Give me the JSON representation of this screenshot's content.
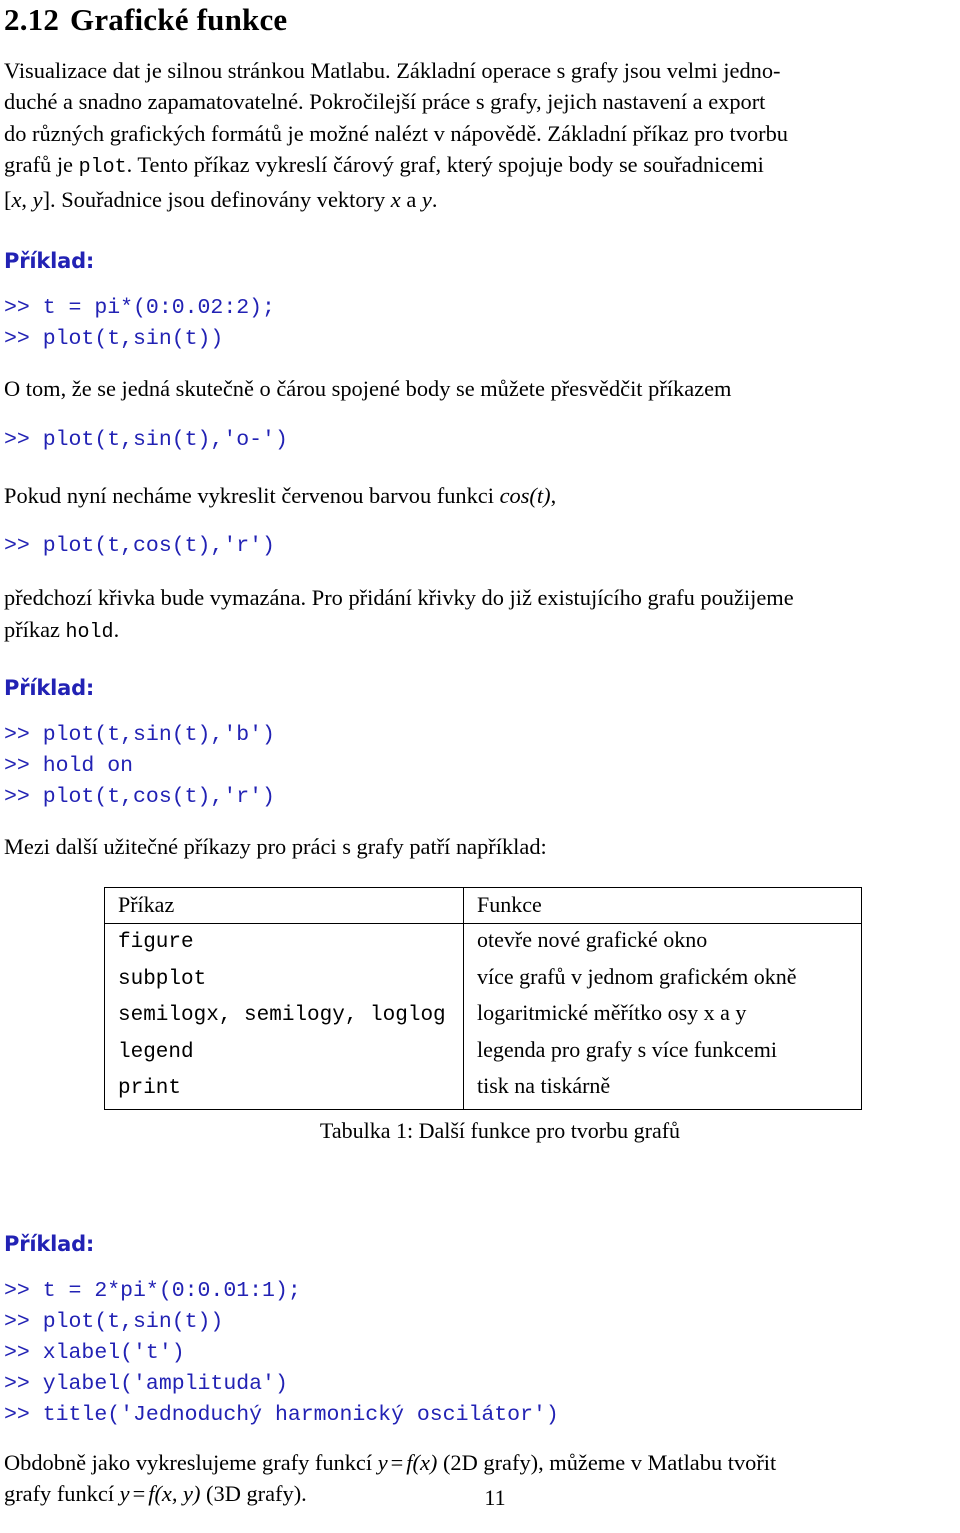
{
  "document": {
    "page_number": "11",
    "code_color": "#2222b4",
    "text_color": "#000000",
    "background_color": "#ffffff"
  },
  "section": {
    "number": "2.12",
    "title": "Grafické funkce"
  },
  "paragraphs": {
    "intro_a": "Visualizace dat je silnou stránkou Matlabu. Základní operace s grafy jsou velmi jedno-",
    "intro_b": "duché a snadno zapamatovatelné. Pokročilejší práce s grafy, jejich nastavení a export",
    "intro_c": "do různých grafických formátů je možné nalézt v nápovědě. Základní příkaz pro tvorbu",
    "intro_d_1": "grafů je ",
    "intro_d_code": "plot",
    "intro_d_2": ". Tento příkaz vykreslí čárový graf, který spojuje body se souřadnicemi",
    "intro_e_1": "[",
    "intro_e_x": "x",
    "intro_e_comma": ", ",
    "intro_e_y": "y",
    "intro_e_2": "]. Souřadnice jsou definovány vektory ",
    "intro_e_x2": "x",
    "intro_e_3": " a ",
    "intro_e_y2": "y",
    "intro_e_4": ".",
    "after_first_code": "O tom, že se jedná skutečně o čárou spojené body se můžete přesvědčit příkazem",
    "before_red_1": "Pokud nyní necháme vykreslit červenou barvou funkci ",
    "before_red_math": "cos(t)",
    "before_red_2": ",",
    "after_red_a": "předchozí křivka bude vymazána. Pro přidání křivky do již existujícího grafu použijeme",
    "after_red_b_1": "příkaz ",
    "after_red_b_code": "hold",
    "after_red_b_2": ".",
    "before_table": "Mezi další užitečné příkazy pro práci s grafy patří například:",
    "closing_a_1": "Obdobně jako vykreslujeme grafy funkcí ",
    "closing_a_y": "y",
    "closing_a_eq": "=",
    "closing_a_f": "f",
    "closing_a_arg": "(x)",
    "closing_a_2": " (2D grafy), můžeme v Matlabu tvořit",
    "closing_b_1": "grafy funkcí ",
    "closing_b_y": "y",
    "closing_b_eq": "=",
    "closing_b_f": "f",
    "closing_b_arg": "(x, y)",
    "closing_b_2": " (3D grafy)."
  },
  "labels": {
    "priklad": "Příklad:"
  },
  "code_blocks": {
    "block1": [
      ">> t = pi*(0:0.02:2);",
      ">> plot(t,sin(t))"
    ],
    "block2": [
      ">> plot(t,sin(t),'o-')"
    ],
    "block3": [
      ">> plot(t,cos(t),'r')"
    ],
    "block4": [
      ">> plot(t,sin(t),'b')",
      ">> hold on",
      ">> plot(t,cos(t),'r')"
    ],
    "block5": [
      ">> t = 2*pi*(0:0.01:1);",
      ">> plot(t,sin(t))",
      ">> xlabel('t')",
      ">> ylabel('amplituda')",
      ">> title('Jednoduchý harmonický oscilátor')"
    ]
  },
  "table": {
    "caption": "Tabulka 1: Další funkce pro tvorbu grafů",
    "headers": [
      "Příkaz",
      "Funkce"
    ],
    "rows": [
      {
        "command": "figure",
        "description": "otevře nové grafické okno"
      },
      {
        "command": "subplot",
        "description": "více grafů v jednom grafickém okně"
      },
      {
        "command": "semilogx, semilogy, loglog",
        "description": "logaritmické měřítko osy x a y"
      },
      {
        "command": "legend",
        "description": "legenda pro grafy s více funkcemi"
      },
      {
        "command": "print",
        "description": "tisk na tiskárně"
      }
    ]
  }
}
